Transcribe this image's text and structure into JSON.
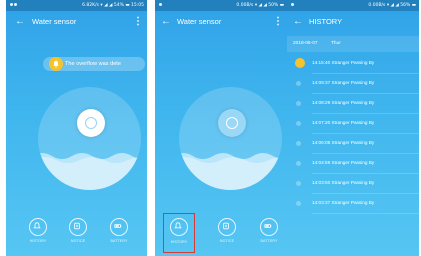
{
  "colors": {
    "accent": "#2fa2e8",
    "alert": "#f6c32d",
    "highlight": "#d93b34"
  },
  "screen1": {
    "status": {
      "speed": "6.82K/s",
      "battery": "54%",
      "time": "15:05"
    },
    "title": "Water sensor",
    "back_icon": "arrow-left-icon",
    "menu_icon": "more-vertical-icon",
    "toast": "The overflow was dete",
    "nav": [
      {
        "label": "HISTORY",
        "icon": "bell-icon"
      },
      {
        "label": "NOTICE",
        "icon": "notice-icon"
      },
      {
        "label": "BATTERY",
        "icon": "battery-icon"
      }
    ]
  },
  "screen2": {
    "status": {
      "speed": "0.00B/s",
      "battery": "50%",
      "time": ""
    },
    "title": "Water sensor",
    "back_icon": "arrow-left-icon",
    "menu_icon": "more-vertical-icon",
    "nav": [
      {
        "label": "HISTORY",
        "icon": "bell-icon"
      },
      {
        "label": "NOTICE",
        "icon": "notice-icon"
      },
      {
        "label": "BATTERY",
        "icon": "battery-icon"
      }
    ]
  },
  "screen3": {
    "status": {
      "speed": "0.00B/s",
      "battery": "56%",
      "time": ""
    },
    "title": "HISTORY",
    "back_icon": "arrow-left-icon",
    "date": "2018-06-07",
    "day": "Thur",
    "entries": [
      "14:15:40 Stranger Passing By",
      "14:09:37 Stranger Passing By",
      "14:08:29 Stranger Passing By",
      "14:07:20 Stranger Passing By",
      "14:06:08 Stranger Passing By",
      "14:04:59 Stranger Passing By",
      "14:03:50 Stranger Passing By",
      "14:03:37 Stranger Passing By"
    ]
  }
}
